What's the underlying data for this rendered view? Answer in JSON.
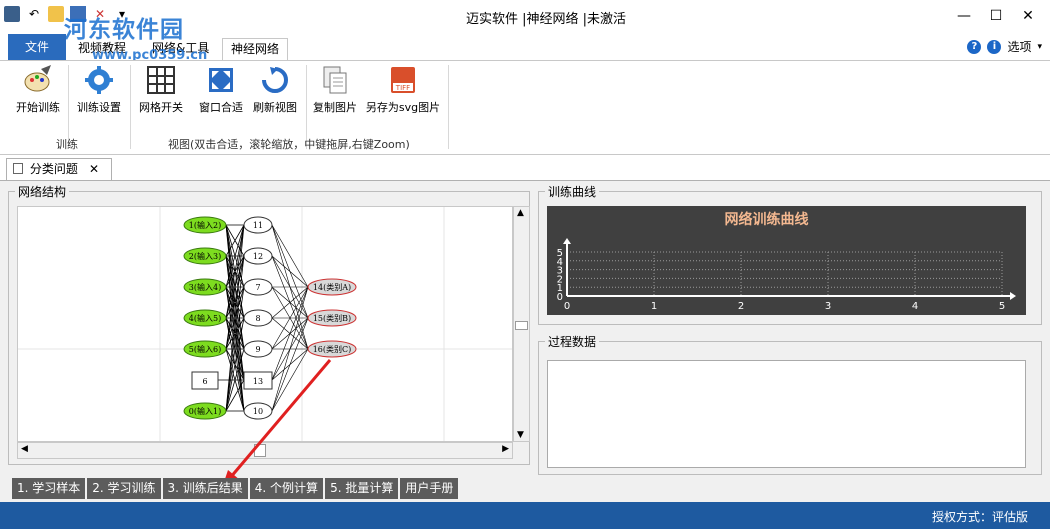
{
  "app": {
    "title": "迈实软件 |神经网络 |未激活",
    "watermark": "河东软件园",
    "watermark_url": "www.pc0359.cn"
  },
  "ribbon_tabs": [
    "文件",
    "视频教程",
    "网络&工具",
    "神经网络"
  ],
  "options_label": "选项",
  "ribbon": {
    "buttons": [
      {
        "label": "开始训练",
        "icon": "paint-palette-icon"
      },
      {
        "label": "训练设置",
        "icon": "gear-icon"
      },
      {
        "label": "网格开关",
        "icon": "grid-icon"
      },
      {
        "label": "窗口合适",
        "icon": "fit-window-icon"
      },
      {
        "label": "刷新视图",
        "icon": "refresh-icon"
      },
      {
        "label": "复制图片",
        "icon": "copy-image-icon"
      },
      {
        "label": "另存为svg图片",
        "icon": "tiff-save-icon"
      }
    ],
    "groups": [
      "训练",
      "视图(双击合适，滚轮缩放，中键拖屏,右键Zoom)"
    ]
  },
  "doc_tab": "分类问题",
  "network_panel": {
    "title": "网络结构",
    "input_nodes": [
      "1(输入2)",
      "2(输入3)",
      "3(输入4)",
      "4(输入5)",
      "5(输入6)",
      "0(输入1)"
    ],
    "hidden_nodes": [
      "11",
      "12",
      "7",
      "8",
      "9",
      "13",
      "10"
    ],
    "output_nodes": [
      "14(类别A)",
      "15(类别B)",
      "16(类别C)"
    ],
    "box_node": "6"
  },
  "training_panel": {
    "title": "训练曲线",
    "chart_title": "网络训练曲线"
  },
  "chart_data": {
    "type": "line",
    "title": "网络训练曲线",
    "x_ticks": [
      "0",
      "1",
      "2",
      "3",
      "4",
      "5"
    ],
    "y_ticks": [
      "0",
      "1",
      "2",
      "3",
      "4",
      "5"
    ],
    "xlim": [
      0,
      5
    ],
    "ylim": [
      0,
      5
    ],
    "grid": true,
    "series": []
  },
  "process_panel": {
    "title": "过程数据"
  },
  "bottom_tabs": [
    "1. 学习样本",
    "2. 学习训练",
    "3. 训练后结果",
    "4. 个例计算",
    "5. 批量计算",
    "用户手册"
  ],
  "status": "授权方式：评估版",
  "colors": {
    "accent": "#1e5aa0",
    "input_node": "#7ddc1f",
    "output_node": "#d9d9d9",
    "arrow": "#e02020"
  }
}
